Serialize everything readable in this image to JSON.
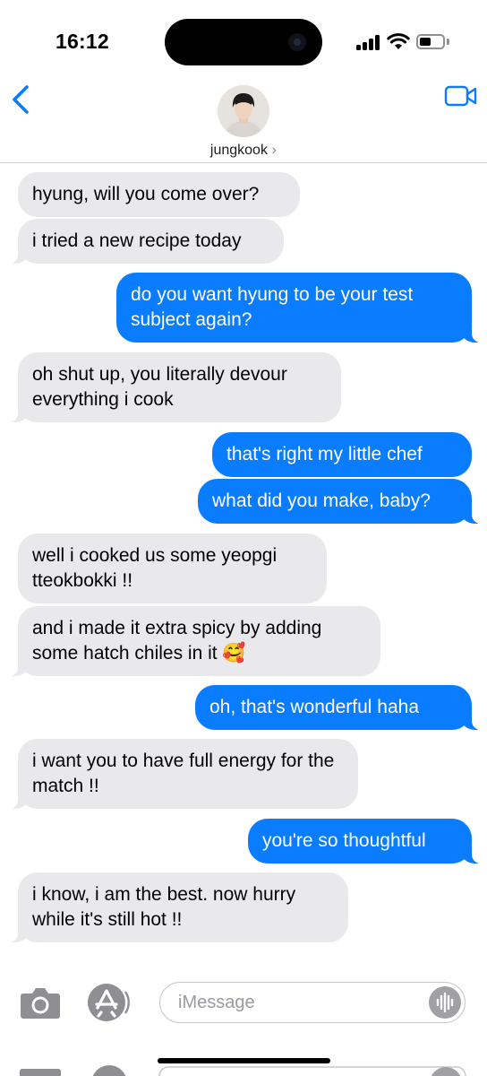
{
  "status": {
    "time": "16:12",
    "battery_level": 0.5
  },
  "header": {
    "contact_name": "jungkook",
    "chevron": "›",
    "back_icon": "chevron-left-icon",
    "video_icon": "video-camera-icon"
  },
  "messages": [
    {
      "from": "them",
      "text": "hyung, will you come over?"
    },
    {
      "from": "them",
      "text": "i tried a new recipe today"
    },
    {
      "from": "me",
      "text": "do you want hyung to be your test subject again?"
    },
    {
      "from": "them",
      "text": "oh shut up, you literally devour everything i cook"
    },
    {
      "from": "me",
      "text": "that's right my little chef"
    },
    {
      "from": "me",
      "text": "what did you make, baby?"
    },
    {
      "from": "them",
      "text": "well i cooked us some yeopgi tteokbokki !!"
    },
    {
      "from": "them",
      "text": "and i made it extra spicy by adding some hatch chiles in it 🥰"
    },
    {
      "from": "me",
      "text": "oh, that's wonderful haha"
    },
    {
      "from": "them",
      "text": "i want you to have full energy for the match !!"
    },
    {
      "from": "me",
      "text": "you're so thoughtful"
    },
    {
      "from": "them",
      "text": "i know, i am the best. now hurry while it's still hot !!"
    }
  ],
  "composer": {
    "placeholder": "iMessage",
    "camera_icon": "camera-icon",
    "apps_icon": "app-store-icon",
    "audio_icon": "audio-waveform-icon"
  },
  "colors": {
    "sent_bubble": "#0a7cff",
    "received_bubble": "#e9e9eb",
    "accent": "#0a7cff"
  }
}
